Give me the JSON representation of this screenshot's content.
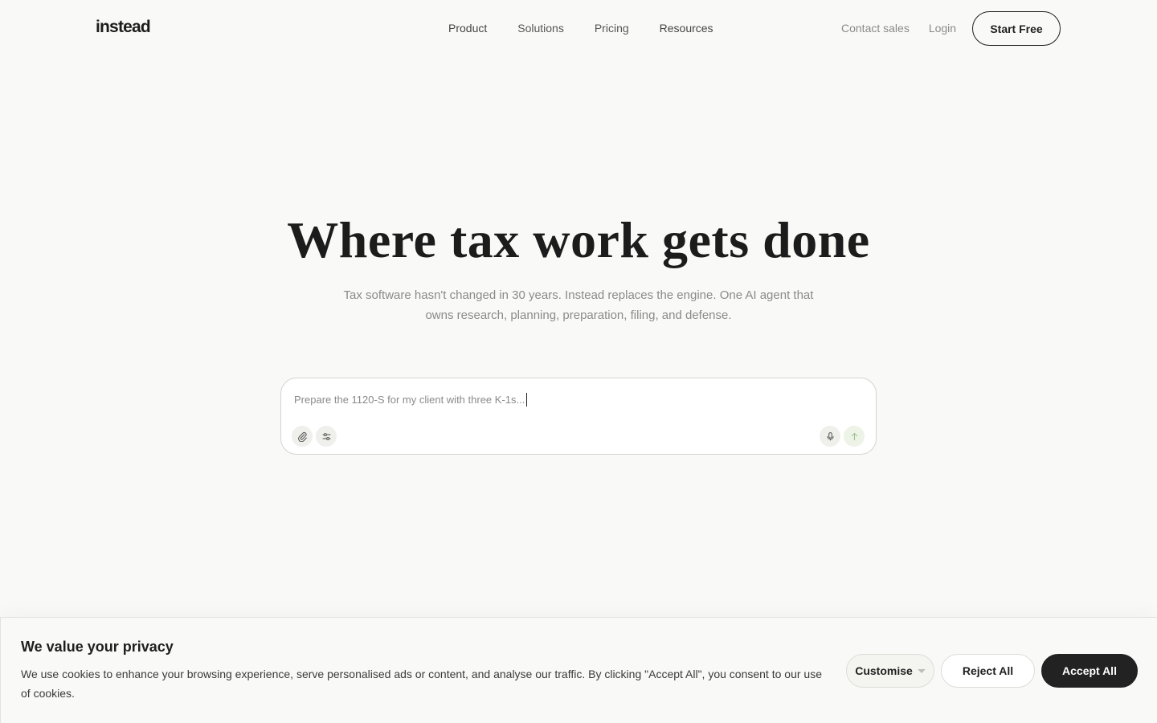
{
  "header": {
    "logo": "instead",
    "nav": [
      "Product",
      "Solutions",
      "Pricing",
      "Resources"
    ],
    "contact_sales": "Contact sales",
    "login": "Login",
    "start_free": "Start Free"
  },
  "hero": {
    "title": "Where tax work gets done",
    "subtitle_line1": "Tax software hasn't changed in 30 years. Instead replaces the engine. One AI agent that",
    "subtitle_line2": "owns research, planning, preparation, filing, and defense."
  },
  "prompt": {
    "placeholder": "Prepare the 1120-S for my client with three K-1s..."
  },
  "cookie": {
    "title": "We value your privacy",
    "body": "We use cookies to enhance your browsing experience, serve personalised ads or content, and analyse our traffic. By clicking \"Accept All\", you consent to our use of cookies.",
    "customise": "Customise",
    "reject": "Reject All",
    "accept": "Accept All"
  },
  "icons": {
    "attach": "paperclip-icon",
    "settings": "sliders-icon",
    "mic": "microphone-icon",
    "send": "arrow-up-icon"
  }
}
